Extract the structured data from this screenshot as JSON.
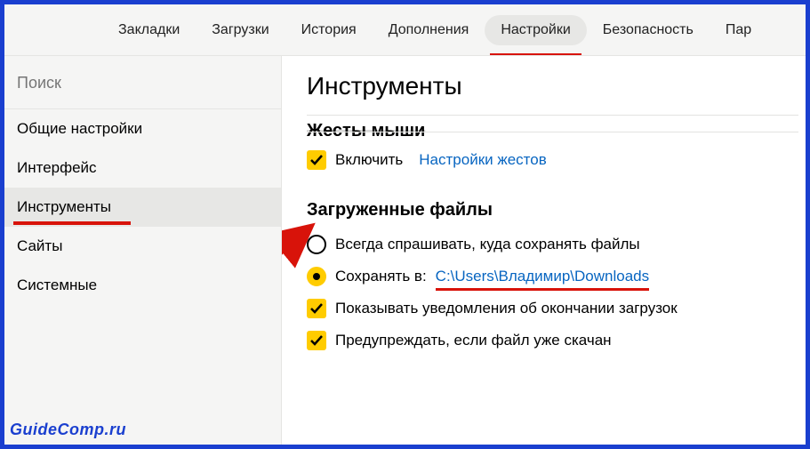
{
  "topnav": {
    "items": [
      {
        "label": "Закладки"
      },
      {
        "label": "Загрузки"
      },
      {
        "label": "История"
      },
      {
        "label": "Дополнения"
      },
      {
        "label": "Настройки",
        "active": true
      },
      {
        "label": "Безопасность"
      },
      {
        "label": "Пар"
      }
    ]
  },
  "sidebar": {
    "search_placeholder": "Поиск",
    "items": [
      {
        "label": "Общие настройки"
      },
      {
        "label": "Интерфейс"
      },
      {
        "label": "Инструменты",
        "active": true
      },
      {
        "label": "Сайты"
      },
      {
        "label": "Системные"
      }
    ]
  },
  "content": {
    "page_title": "Инструменты",
    "mouse_gestures": {
      "heading": "Жесты мыши",
      "enable_label": "Включить",
      "settings_link": "Настройки жестов"
    },
    "downloads": {
      "heading": "Загруженные файлы",
      "ask_label": "Всегда спрашивать, куда сохранять файлы",
      "save_to_label": "Сохранять в:",
      "save_to_path": "C:\\Users\\Владимир\\Downloads",
      "notify_label": "Показывать уведомления об окончании загрузок",
      "warn_label": "Предупреждать, если файл уже скачан"
    }
  },
  "watermark": "GuideComp.ru"
}
